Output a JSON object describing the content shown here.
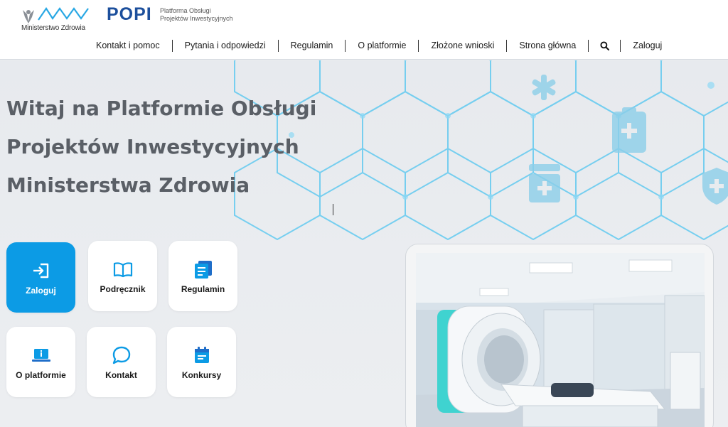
{
  "header": {
    "ministry_label": "Ministerstwo Zdrowia",
    "popi_logo": "POPI",
    "popi_subtitle_line1": "Platforma Obsługi",
    "popi_subtitle_line2": "Projektów Inwestycyjnych"
  },
  "nav": {
    "items": [
      {
        "label": "Kontakt i pomoc"
      },
      {
        "label": "Pytania i odpowiedzi"
      },
      {
        "label": "Regulamin"
      },
      {
        "label": "O platformie"
      },
      {
        "label": "Złożone wnioski"
      },
      {
        "label": "Strona główna"
      }
    ],
    "search_icon": "search-icon",
    "login_label": "Zaloguj"
  },
  "hero": {
    "title_line1": "Witaj na Platformie Obsługi",
    "title_line2": "Projektów Inwestycyjnych",
    "title_line3": "Ministerstwa Zdrowia"
  },
  "tiles": [
    {
      "label": "Zaloguj",
      "icon": "login-icon"
    },
    {
      "label": "Podręcznik",
      "icon": "book-icon"
    },
    {
      "label": "Regulamin",
      "icon": "document-list-icon"
    },
    {
      "label": "O platformie",
      "icon": "laptop-info-icon"
    },
    {
      "label": "Kontakt",
      "icon": "chat-bubble-icon"
    },
    {
      "label": "Konkursy",
      "icon": "calendar-icon"
    }
  ],
  "colors": {
    "accent": "#0c9be5",
    "brand": "#1c4f9c",
    "hex_line": "#5cc8f0"
  }
}
